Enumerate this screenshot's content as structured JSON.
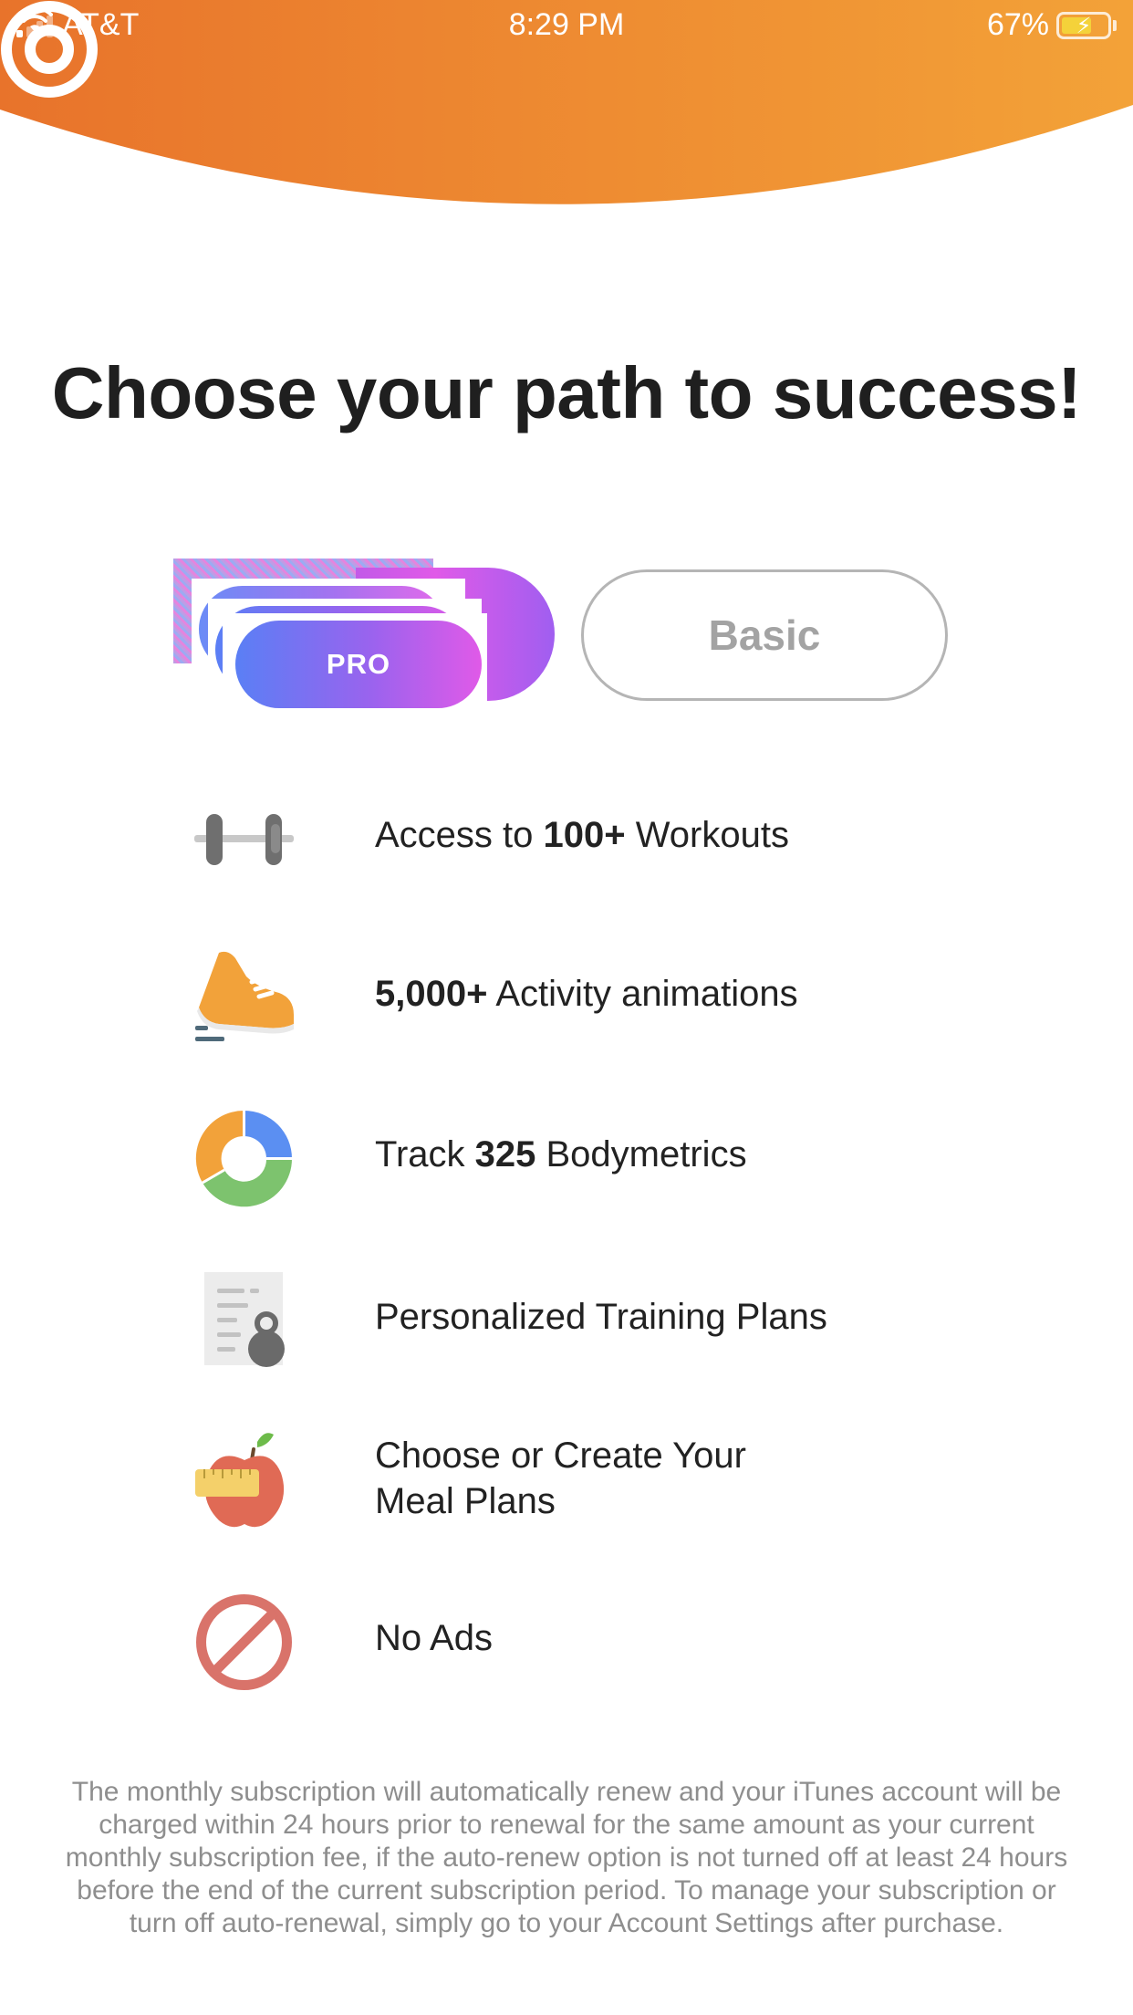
{
  "status_bar": {
    "carrier": "AT&T",
    "time": "8:29 PM",
    "battery_percent": "67%",
    "battery_level": 0.67,
    "signal_bars_filled": 1
  },
  "header": {
    "logo_icon": "target-icon",
    "gradient_colors": [
      "#e8732b",
      "#f3a238"
    ]
  },
  "title": "Choose your path to success!",
  "plans": {
    "pro_label": "PRO",
    "basic_label": "Basic",
    "selected": "PRO"
  },
  "features": [
    {
      "icon": "dumbbell-icon",
      "pre": "Access to ",
      "bold": "100+",
      "post": " Workouts"
    },
    {
      "icon": "running-shoe-icon",
      "pre": "",
      "bold": "5,000+",
      "post": " Activity animations"
    },
    {
      "icon": "donut-chart-icon",
      "pre": "Track ",
      "bold": "325",
      "post": " Bodymetrics"
    },
    {
      "icon": "training-plan-icon",
      "pre": "Personalized Training Plans",
      "bold": "",
      "post": ""
    },
    {
      "icon": "apple-icon",
      "line1": "Choose or Create Your",
      "line2": "Meal Plans"
    },
    {
      "icon": "no-ads-icon",
      "pre": "No Ads",
      "bold": "",
      "post": ""
    }
  ],
  "disclaimer": "The monthly subscription will automatically renew and your iTunes account will be charged within 24 hours prior to renewal for the same amount as your current monthly subscription fee, if the auto-renew option is not turned off at least 24 hours before the end of the current subscription period. To manage your subscription or turn off auto-renewal, simply go to your Account Settings after purchase."
}
